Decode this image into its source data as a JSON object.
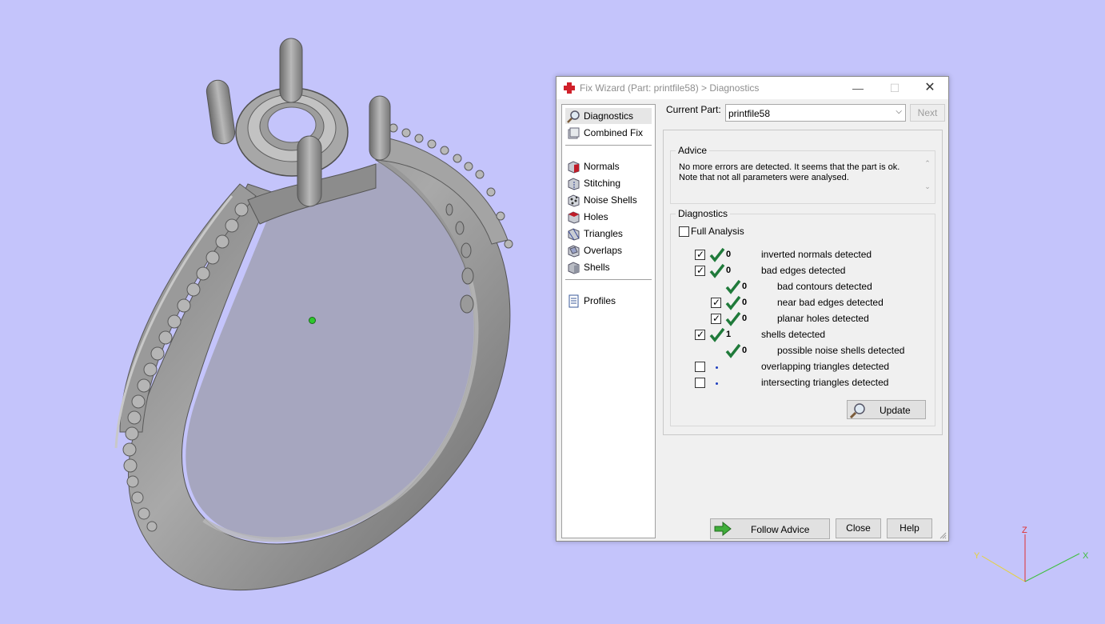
{
  "window": {
    "title": "Fix Wizard (Part: printfile58) > Diagnostics",
    "minimize_symbol": "—",
    "maximize_symbol": "☐",
    "close_symbol": "✕"
  },
  "sidebar": {
    "items": [
      {
        "label": "Diagnostics",
        "icon": "magnifier-icon"
      },
      {
        "label": "Combined Fix",
        "icon": "combined-fix-icon"
      },
      {
        "label": "Normals",
        "icon": "normals-icon"
      },
      {
        "label": "Stitching",
        "icon": "stitching-icon"
      },
      {
        "label": "Noise Shells",
        "icon": "noise-shells-icon"
      },
      {
        "label": "Holes",
        "icon": "holes-icon"
      },
      {
        "label": "Triangles",
        "icon": "triangles-icon"
      },
      {
        "label": "Overlaps",
        "icon": "overlaps-icon"
      },
      {
        "label": "Shells",
        "icon": "shells-icon"
      },
      {
        "label": "Profiles",
        "icon": "profiles-icon"
      }
    ]
  },
  "current_part": {
    "label": "Current Part:",
    "value": "printfile58",
    "next_label": "Next"
  },
  "advice": {
    "title": "Advice",
    "line1": "No more errors are detected. It seems that the part is ok.",
    "line2": "Note that not all parameters were analysed.",
    "scroll_up": "⌃",
    "scroll_down": "⌄"
  },
  "diagnostics": {
    "title": "Diagnostics",
    "full_analysis_label": "Full Analysis",
    "full_analysis_checked": false,
    "rows": [
      {
        "count": "0",
        "label": "inverted normals detected",
        "checked": true
      },
      {
        "count": "0",
        "label": "bad edges detected",
        "checked": true
      },
      {
        "count": "0",
        "label": "bad contours detected"
      },
      {
        "count": "0",
        "label": "near bad edges detected",
        "checked": true
      },
      {
        "count": "0",
        "label": "planar holes detected",
        "checked": true
      },
      {
        "count": "1",
        "label": "shells detected",
        "checked": true
      },
      {
        "count": "0",
        "label": "possible noise shells detected"
      },
      {
        "label": "overlapping triangles detected",
        "checked": false
      },
      {
        "label": "intersecting triangles detected",
        "checked": false
      }
    ],
    "update_label": "Update",
    "check_mark": "✓"
  },
  "footer": {
    "follow_advice_label": "Follow Advice",
    "close_label": "Close",
    "help_label": "Help"
  },
  "axis": {
    "x": "X",
    "y": "Y",
    "z": "Z"
  },
  "colors": {
    "viewport_background": "#c4c4fb",
    "tick_green": "#1f7a3a",
    "axis_x": "#3fbf3f",
    "axis_y": "#e6d23c",
    "axis_z": "#e03030"
  }
}
